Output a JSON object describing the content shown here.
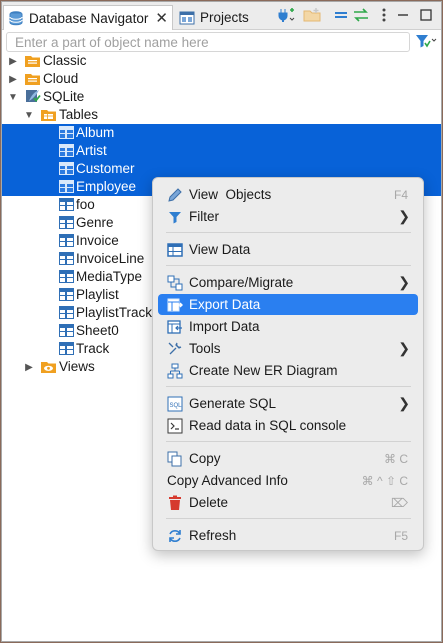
{
  "tabs": [
    {
      "label": "Database Navigator",
      "icon": "database-navigator-icon",
      "active": true,
      "close": "✕"
    },
    {
      "label": "Projects",
      "icon": "projects-icon",
      "active": false
    }
  ],
  "filter": {
    "placeholder": "Enter a part of object name here",
    "value": ""
  },
  "tree": {
    "connections": [
      {
        "label": "Classic",
        "expanded": false
      },
      {
        "label": "Cloud",
        "expanded": false
      },
      {
        "label": "SQLite",
        "expanded": true
      }
    ],
    "tables_folder": "Tables",
    "tables": [
      "Album",
      "Artist",
      "Customer",
      "Employee",
      "foo",
      "Genre",
      "Invoice",
      "InvoiceLine",
      "MediaType",
      "Playlist",
      "PlaylistTrack",
      "Sheet0",
      "Track"
    ],
    "selected_tables": [
      "Album",
      "Artist",
      "Customer",
      "Employee"
    ],
    "views_folder": "Views"
  },
  "menu": {
    "items": [
      {
        "label": "View  Objects",
        "icon": "view-objects-icon",
        "shortcut": "F4"
      },
      {
        "label": "Filter",
        "icon": "filter-icon",
        "submenu": true
      },
      {
        "label": "View Data",
        "icon": "view-data-icon"
      },
      {
        "label": "Compare/Migrate",
        "icon": "compare-migrate-icon",
        "submenu": true
      },
      {
        "label": "Export Data",
        "icon": "export-data-icon",
        "highlighted": true
      },
      {
        "label": "Import Data",
        "icon": "import-data-icon"
      },
      {
        "label": "Tools",
        "icon": "tools-icon",
        "submenu": true
      },
      {
        "label": "Create New ER Diagram",
        "icon": "er-diagram-icon"
      },
      {
        "label": "Generate SQL",
        "icon": "generate-sql-icon",
        "submenu": true
      },
      {
        "label": "Read data in SQL console",
        "icon": "sql-console-icon"
      },
      {
        "label": "Copy",
        "icon": "copy-icon",
        "shortcut": "⌘ C"
      },
      {
        "label": "Copy Advanced Info",
        "shortcut": "⌘ ^ ⇧ C"
      },
      {
        "label": "Delete",
        "icon": "delete-icon",
        "shortcut": "⌦"
      },
      {
        "label": "Refresh",
        "icon": "refresh-icon",
        "shortcut": "F5"
      }
    ]
  },
  "colors": {
    "selection": "#0862d8",
    "menu_highlight": "#2a7ff0",
    "folder": "#f0a020",
    "table": "#2f6fb6"
  }
}
